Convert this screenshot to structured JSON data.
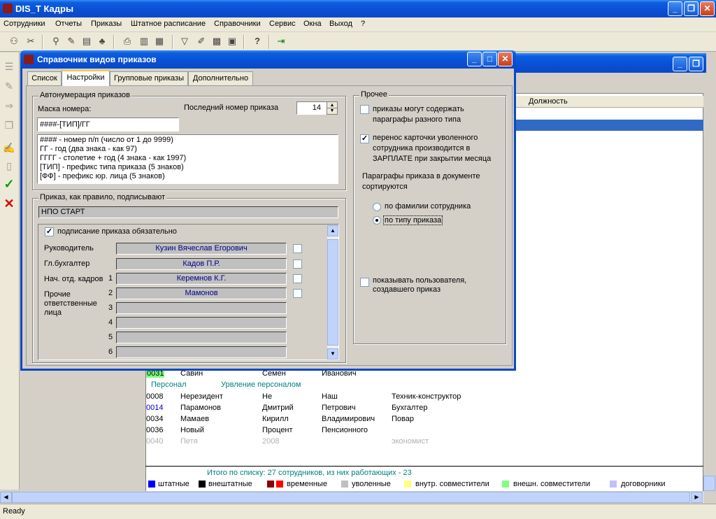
{
  "app": {
    "title": "DIS_T Кадры",
    "status": "Ready"
  },
  "menu": [
    "Сотрудники",
    "Отчеты",
    "Приказы",
    "Штатное расписание",
    "Справочники",
    "Сервис",
    "Окна",
    "Выход",
    "?"
  ],
  "main_window": {
    "column_header": "Должность",
    "rows": [
      {
        "code": "0031",
        "last": "Савин",
        "first": "Семен",
        "middle": "Иванович",
        "position": ""
      },
      {
        "dept": "Персонал",
        "subdept": "Урвление персоналом"
      },
      {
        "code": "0008",
        "last": "Нерезидент",
        "first": "Не",
        "middle": "Наш",
        "position": "Техник-конструктор"
      },
      {
        "code": "0014",
        "last": "Парамонов",
        "first": "Дмитрий",
        "middle": "Петрович",
        "position": "Бухгалтер"
      },
      {
        "code": "0034",
        "last": "Мамаев",
        "first": "Кирилл",
        "middle": "Владимирович",
        "position": "Повар"
      },
      {
        "code": "0036",
        "last": "Новый",
        "first": "Процент",
        "middle": "Пенсионного",
        "position": ""
      },
      {
        "code": "0040",
        "last": "Петя",
        "first": "2008",
        "middle": "",
        "position": "экономист"
      }
    ],
    "summary": "Итого по списку: 27 сотрудников, из них работающих - 23",
    "legend": [
      {
        "label": "штатные",
        "color": "#0000ff"
      },
      {
        "label": "внештатные",
        "color": "#000000"
      },
      {
        "label": "временные",
        "color": "#8b0000",
        "color2": "#ff0000"
      },
      {
        "label": "уволенные",
        "color": "#c0c0c0"
      },
      {
        "label": "внутр. совместители",
        "color": "#ffff80"
      },
      {
        "label": "внешн. совместители",
        "color": "#80ff80"
      },
      {
        "label": "договорники",
        "color": "#c0c0ff"
      }
    ]
  },
  "dialog": {
    "title": "Справочник видов приказов",
    "tabs": [
      "Список",
      "Настройки",
      "Групповые приказы",
      "Дополнительно"
    ],
    "autonum": {
      "legend": "Автонумерация приказов",
      "mask_label": "Маска номера:",
      "mask_value": "####-[ТИП]/ГГ",
      "last_label": "Последний номер приказа",
      "last_value": "14",
      "help": [
        "#### - номер п/п (число от 1 до 9999)",
        "ГГ - год (два знака - как 97)",
        "ГГГГ  -  столетие + год (4 знака - как 1997)",
        "[ТИП] - префикс типа приказа (5 знаков)",
        "[ФФ] - префикс юр. лица (5 знаков)"
      ]
    },
    "signers": {
      "legend": "Приказ, как правило, подписывают",
      "org": "НПО СТАРТ",
      "required_label": "подписание приказа обязательно",
      "director_label": "Руководитель",
      "director": "Кузин Вячеслав Егорович",
      "accountant_label": "Гл.бухгалтер",
      "accountant": "Кадов П.Р.",
      "hr_label": "Нач. отд. кадров",
      "others_label": "Прочие ответственные лица",
      "numbers": [
        "1",
        "2",
        "3",
        "4",
        "5",
        "6"
      ],
      "persons": [
        "Керемнов К.Г.",
        "Мамонов",
        "",
        "",
        "",
        ""
      ]
    },
    "other": {
      "legend": "Прочее",
      "opt1": "приказы могут содержать параграфы разного типа",
      "opt2": "перенос карточки уволенного сотрудника производится  в ЗАРПЛАТЕ при закрытии месяца",
      "sort_label": "Параграфы приказа в документе сортируются",
      "sort_opt1": "по фамилии сотрудника",
      "sort_opt2": "по типу приказа",
      "opt3": "показывать пользователя, создавшего приказ"
    }
  }
}
